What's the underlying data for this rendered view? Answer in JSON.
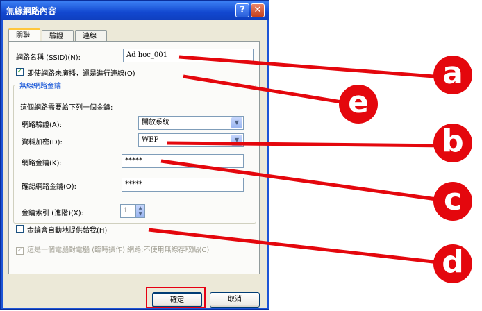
{
  "window": {
    "title": "無線網路內容"
  },
  "tabs": [
    {
      "label": "關聯"
    },
    {
      "label": "驗證"
    },
    {
      "label": "連線"
    }
  ],
  "form": {
    "ssid_label": "網路名稱 (SSID)(N):",
    "ssid_value": "Ad hoc_001",
    "broadcast_label": "即使網路未廣播，還是進行連線(O)",
    "broadcast_checked": true,
    "group_title": "無線網路金鑰",
    "key_required_text": "這個網路需要給下列一個金鑰:",
    "auth_label": "網路驗證(A):",
    "auth_value": "開放系統",
    "encrypt_label": "資料加密(D):",
    "encrypt_value": "WEP",
    "netkey_label": "網路金鑰(K):",
    "netkey_value": "*****",
    "confirm_label": "確認網路金鑰(O):",
    "confirm_value": "*****",
    "keyindex_label": "金鑰索引 (進階)(X):",
    "keyindex_value": "1",
    "auto_key_label": "金鑰會自動地提供給我(H)",
    "auto_key_checked": false,
    "adhoc_label": "這是一個電腦對電腦 (臨時操作) 網路;不使用無線存取點(C)",
    "adhoc_checked": true
  },
  "buttons": {
    "ok": "確定",
    "cancel": "取消"
  },
  "callouts": [
    "a",
    "e",
    "b",
    "c",
    "d"
  ],
  "colors": {
    "callout": "#e4070d",
    "titlebar": "#1248d0"
  }
}
